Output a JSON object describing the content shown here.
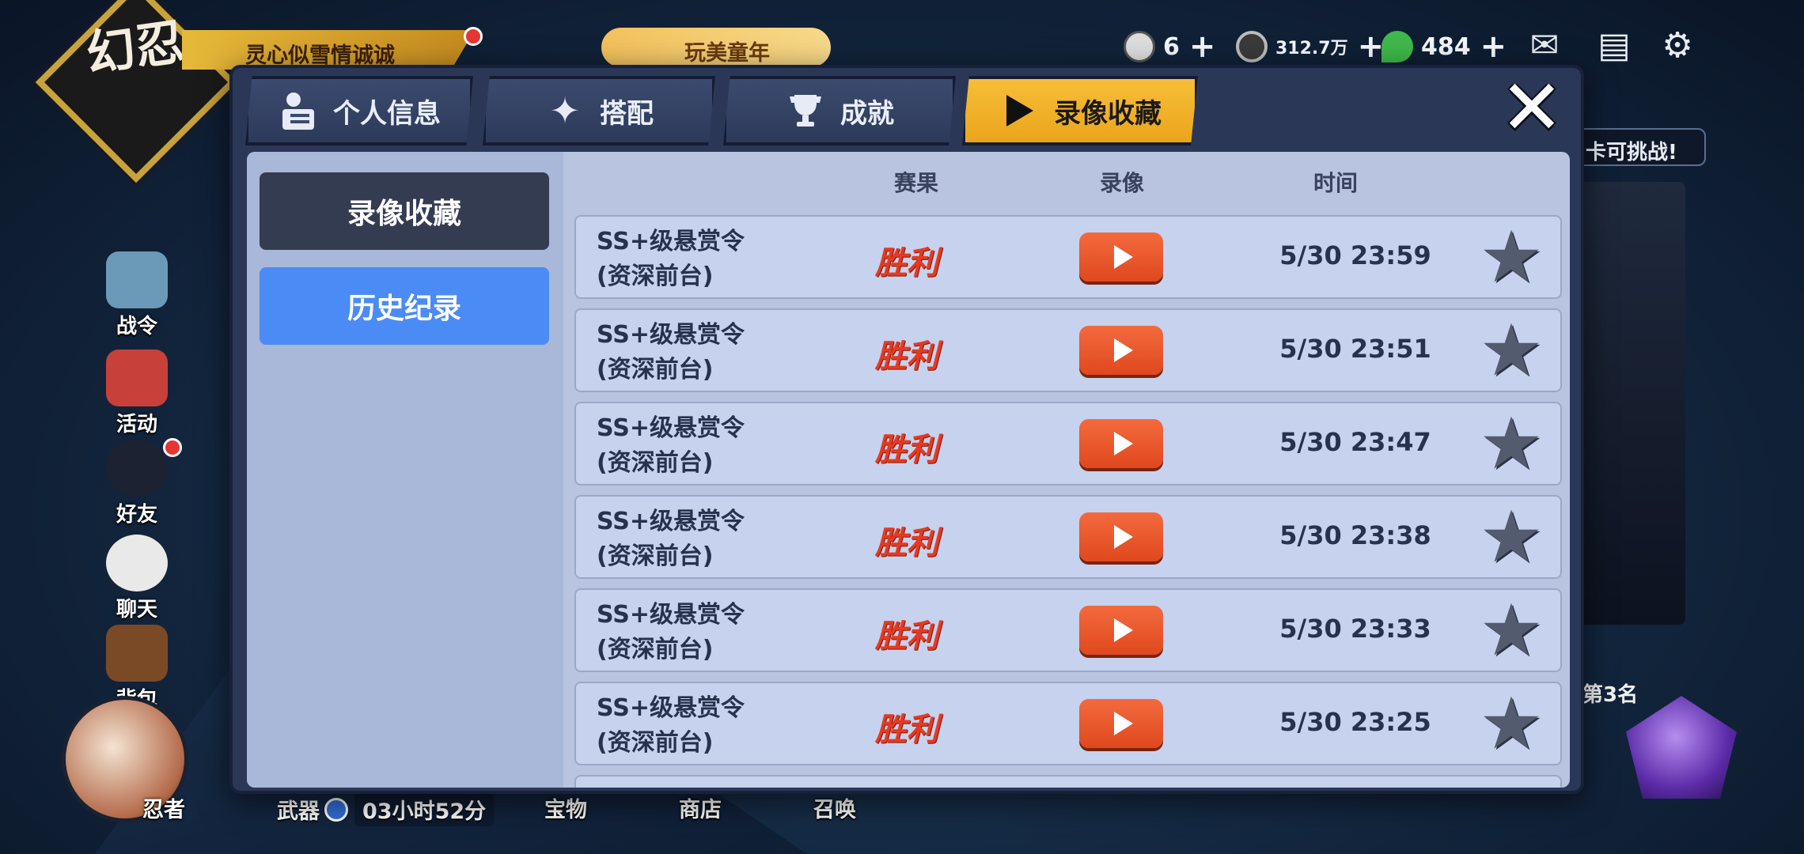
{
  "background": {
    "logo": "幻忍",
    "player_name": "灵心似雪情诚诚",
    "event_banner": "玩美童年",
    "resources": [
      {
        "icon": "rice-ball-icon",
        "value": "6"
      },
      {
        "icon": "coin-icon",
        "value": "312.7万"
      },
      {
        "icon": "jade-icon",
        "value": "484"
      }
    ],
    "side_buttons": [
      "战令",
      "活动",
      "好友",
      "聊天",
      "背包"
    ],
    "bottom_items": [
      "忍者",
      "武器",
      "宝物",
      "商店",
      "召唤"
    ],
    "weapon_timer": "03小时52分",
    "challenge_text": "卡可挑战!",
    "rank_text": "第3名"
  },
  "tabs": [
    {
      "label": "个人信息",
      "icon": "profile-card-icon"
    },
    {
      "label": "搭配",
      "icon": "shuriken-icon"
    },
    {
      "label": "成就",
      "icon": "trophy-icon"
    },
    {
      "label": "录像收藏",
      "icon": "play-icon",
      "active": true
    }
  ],
  "left_menu": {
    "collection": "录像收藏",
    "history": "历史纪录"
  },
  "columns": {
    "result": "赛果",
    "video": "录像",
    "time": "时间"
  },
  "records": [
    {
      "title1": "SS+级悬赏令",
      "title2": "(资深前台)",
      "result": "胜利",
      "time": "5/30 23:59"
    },
    {
      "title1": "SS+级悬赏令",
      "title2": "(资深前台)",
      "result": "胜利",
      "time": "5/30 23:51"
    },
    {
      "title1": "SS+级悬赏令",
      "title2": "(资深前台)",
      "result": "胜利",
      "time": "5/30 23:47"
    },
    {
      "title1": "SS+级悬赏令",
      "title2": "(资深前台)",
      "result": "胜利",
      "time": "5/30 23:38"
    },
    {
      "title1": "SS+级悬赏令",
      "title2": "(资深前台)",
      "result": "胜利",
      "time": "5/30 23:33"
    },
    {
      "title1": "SS+级悬赏令",
      "title2": "(资深前台)",
      "result": "胜利",
      "time": "5/30 23:25"
    }
  ],
  "colors": {
    "active_tab": "#f2b02a",
    "history_button": "#4b8bf5",
    "play_button": "#e8552a",
    "win_text": "#e53a22"
  }
}
